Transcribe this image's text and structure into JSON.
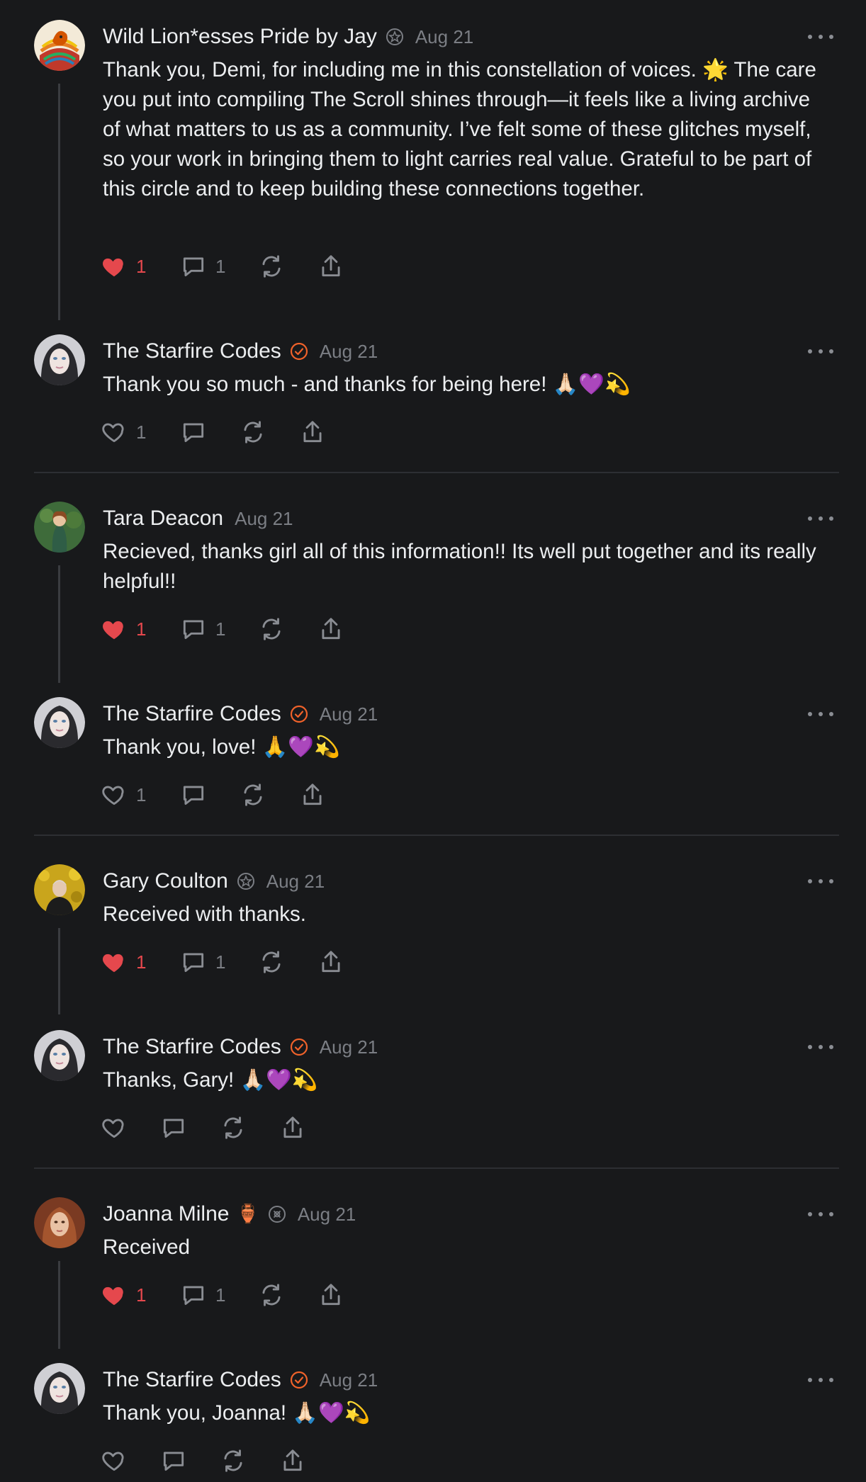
{
  "comments": [
    {
      "author": "Wild Lion*esses Pride by Jay",
      "date": "Aug 21",
      "text": "Thank you, Demi, for including me in this constellation of voices. 🌟 The care you put into compiling The Scroll shines through—it feels like a living archive of what matters to us as a community. I’ve felt some of these glitches myself, so your work in bringing them to light carries real value. Grateful to be part of this circle and to keep building these connections together.",
      "likes": "1",
      "replies": "1",
      "liked": true
    },
    {
      "author": "The Starfire Codes",
      "date": "Aug 21",
      "text": "Thank you so much - and thanks for being here! 🙏🏻💜💫",
      "likes": "1",
      "replies": "",
      "liked": false
    },
    {
      "author": "Tara Deacon",
      "date": "Aug 21",
      "text": "Recieved, thanks girl all of this information!! Its well put together and its really helpful!!",
      "likes": "1",
      "replies": "1",
      "liked": true
    },
    {
      "author": "The Starfire Codes",
      "date": "Aug 21",
      "text": "Thank you, love! 🙏💜💫",
      "likes": "1",
      "replies": "",
      "liked": false
    },
    {
      "author": "Gary Coulton",
      "date": "Aug 21",
      "text": "Received with thanks.",
      "likes": "1",
      "replies": "1",
      "liked": true
    },
    {
      "author": "The Starfire Codes",
      "date": "Aug 21",
      "text": "Thanks, Gary! 🙏🏻💜💫",
      "likes": "",
      "replies": "",
      "liked": false
    },
    {
      "author": "Joanna Milne",
      "author_emoji": "🏺",
      "date": "Aug 21",
      "text": "Received",
      "likes": "1",
      "replies": "1",
      "liked": true
    },
    {
      "author": "The Starfire Codes",
      "date": "Aug 21",
      "text": "Thank you, Joanna! 🙏🏻💜💫",
      "likes": "",
      "replies": "",
      "liked": false
    }
  ],
  "colors": {
    "background": "#18191b",
    "text": "#eceef0",
    "muted": "#7b7e84",
    "like_red": "#e5484d",
    "verified_orange": "#f0622a",
    "thread_line": "#3a3c40"
  },
  "icons": [
    "heart-icon",
    "comment-icon",
    "restack-icon",
    "share-icon",
    "more-icon",
    "verified-badge-icon",
    "subscriber-badge-icon"
  ]
}
